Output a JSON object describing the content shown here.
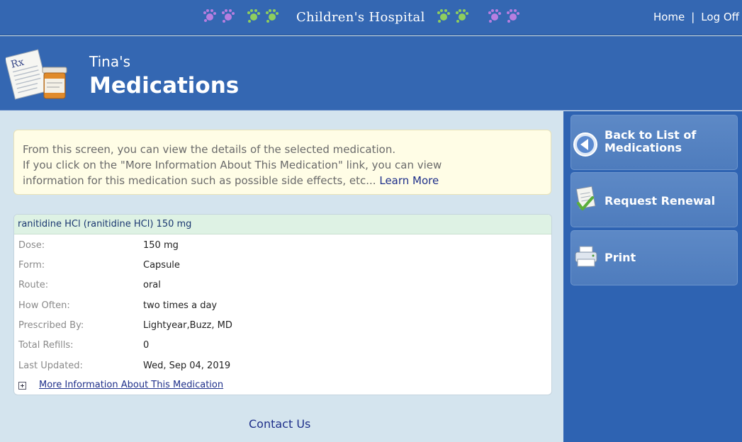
{
  "topbar": {
    "brand": "Children's Hospital",
    "links": [
      {
        "label": "Home"
      },
      {
        "label": "Log Off"
      }
    ],
    "separator": "|"
  },
  "header": {
    "owner": "Tina's",
    "title": "Medications",
    "icon": "rx-prescription-icon",
    "icon_text": "Rx"
  },
  "info": {
    "lines": [
      "From this screen, you can view the details of the selected medication.",
      "If you click on the \"More Information About This Medication\" link, you can view",
      "information for this medication such as possible side effects, etc..."
    ],
    "learn_more": "Learn More"
  },
  "medication": {
    "name": "ranitidine HCl (ranitidine HCl) 150 mg",
    "details": [
      {
        "label": "Dose:",
        "value": "150 mg"
      },
      {
        "label": "Form:",
        "value": "Capsule"
      },
      {
        "label": "Route:",
        "value": "oral"
      },
      {
        "label": "How Often:",
        "value": "two times a day"
      },
      {
        "label": "Prescribed By:",
        "value": "Lightyear,Buzz, MD"
      },
      {
        "label": "Total Refills:",
        "value": "0"
      },
      {
        "label": "Last Updated:",
        "value": "Wed, Sep 04, 2019"
      }
    ],
    "more_info": "More Information About This Medication"
  },
  "footer": {
    "contact": "Contact Us"
  },
  "sidebar": {
    "buttons": [
      {
        "line1": "Back to List of",
        "line2": "Medications",
        "icon": "back-arrow-icon"
      },
      {
        "label": "Request Renewal",
        "icon": "renewal-document-icon"
      },
      {
        "label": "Print",
        "icon": "printer-icon"
      }
    ]
  },
  "colors": {
    "brand_blue": "#3467b2",
    "sidebar_blue": "#2e63b2",
    "page_background": "#d4e4ee",
    "info_background": "#fffde6",
    "medication_header": "#def2e4",
    "link_color": "#1e2f8a"
  }
}
